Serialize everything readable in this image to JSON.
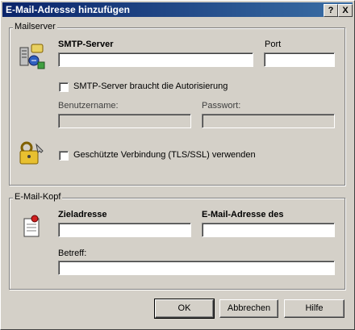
{
  "window": {
    "title": "E-Mail-Adresse hinzufügen",
    "help_btn": "?",
    "close_btn": "X"
  },
  "mailserver": {
    "group_label": "Mailserver",
    "smtp_label": "SMTP-Server",
    "smtp_value": "",
    "port_label": "Port",
    "port_value": "",
    "auth_checkbox_label": "SMTP-Server braucht die Autorisierung",
    "auth_checked": false,
    "username_label": "Benutzername:",
    "username_value": "",
    "password_label": "Passwort:",
    "password_value": "",
    "secure_checkbox_label": "Geschützte Verbindung (TLS/SSL) verwenden",
    "secure_checked": false
  },
  "header": {
    "group_label": "E-Mail-Kopf",
    "target_label": "Zieladresse",
    "target_value": "",
    "sender_label": "E-Mail-Adresse des",
    "sender_value": "",
    "subject_label": "Betreff:",
    "subject_value": ""
  },
  "buttons": {
    "ok": "OK",
    "cancel": "Abbrechen",
    "help": "Hilfe"
  },
  "icons": {
    "server": "server-phone-icon",
    "security": "keys-lock-icon",
    "note": "note-pin-icon"
  }
}
